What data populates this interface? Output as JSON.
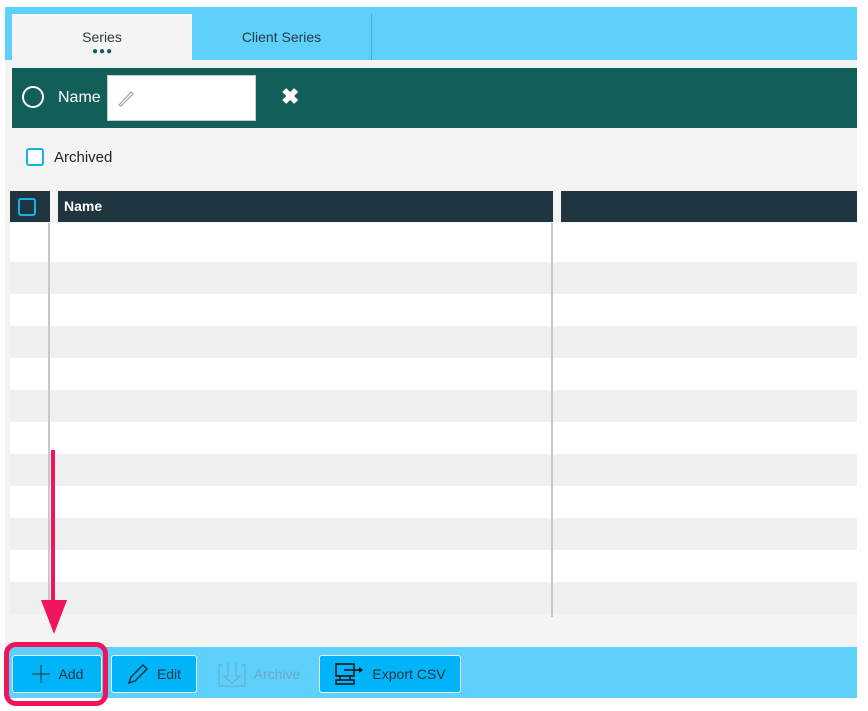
{
  "tabs": [
    {
      "label": "Series",
      "active": true
    },
    {
      "label": "Client Series"
    }
  ],
  "filter": {
    "label": "Name",
    "value": "",
    "clear": "✖"
  },
  "archived": {
    "label": "Archived",
    "checked": false
  },
  "table": {
    "columns": [
      "",
      "Name",
      ""
    ],
    "rows": 12
  },
  "toolbar": {
    "add": "Add",
    "edit": "Edit",
    "archive": "Archive",
    "export": "Export CSV"
  },
  "colors": {
    "accent": "#5dd0fb",
    "filter_bg": "#125e58",
    "header_bg": "#1f3540",
    "highlight": "#f0145a"
  }
}
